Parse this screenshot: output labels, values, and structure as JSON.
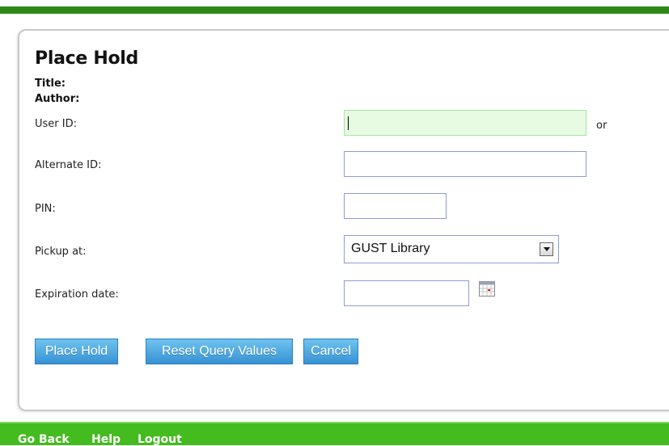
{
  "form": {
    "title": "Place Hold",
    "title_label": "Title:",
    "author_label": "Author:",
    "user_id_label": "User ID:",
    "user_id_value": "",
    "or_text": "or",
    "alternate_id_label": "Alternate ID:",
    "alternate_id_value": "",
    "pin_label": "PIN:",
    "pin_value": "",
    "pickup_label": "Pickup at:",
    "pickup_selected": "GUST Library",
    "expiration_label": "Expiration date:",
    "expiration_value": ""
  },
  "buttons": {
    "place_hold": "Place Hold",
    "reset": "Reset Query Values",
    "cancel": "Cancel"
  },
  "footer": {
    "go_back": "Go Back",
    "help": "Help",
    "logout": "Logout"
  },
  "colors": {
    "top_bar": "#2e8a18",
    "bottom_bar": "#44bb1f",
    "button": "#3792d3",
    "focused_input": "#e6fbe2"
  },
  "icons": {
    "calendar": "calendar-icon",
    "dropdown": "chevron-down-icon"
  }
}
